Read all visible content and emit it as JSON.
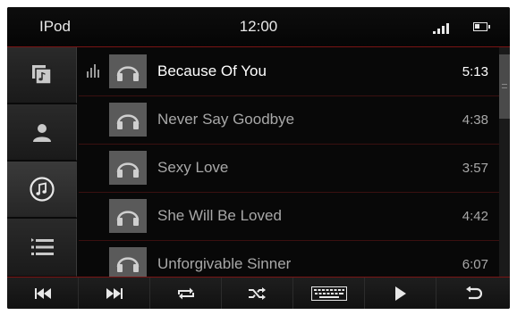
{
  "status": {
    "app_title": "IPod",
    "time": "12:00"
  },
  "sidebar": {
    "items": [
      {
        "name": "album-icon",
        "selected": false
      },
      {
        "name": "artist-icon",
        "selected": false
      },
      {
        "name": "music-note-icon",
        "selected": true
      },
      {
        "name": "playlist-icon",
        "selected": false
      }
    ]
  },
  "tracks": [
    {
      "title": "Because Of You",
      "duration": "5:13",
      "playing": true
    },
    {
      "title": "Never Say Goodbye",
      "duration": "4:38",
      "playing": false
    },
    {
      "title": "Sexy Love",
      "duration": "3:57",
      "playing": false
    },
    {
      "title": "She Will Be Loved",
      "duration": "4:42",
      "playing": false
    },
    {
      "title": "Unforgivable Sinner",
      "duration": "6:07",
      "playing": false
    }
  ],
  "toolbar": {
    "buttons": [
      "previous-icon",
      "next-icon",
      "repeat-icon",
      "shuffle-icon",
      "keyboard-icon",
      "play-icon",
      "back-icon"
    ]
  },
  "colors": {
    "accent": "#7a1414",
    "background": "#080808",
    "text": "#e8e8e8"
  }
}
